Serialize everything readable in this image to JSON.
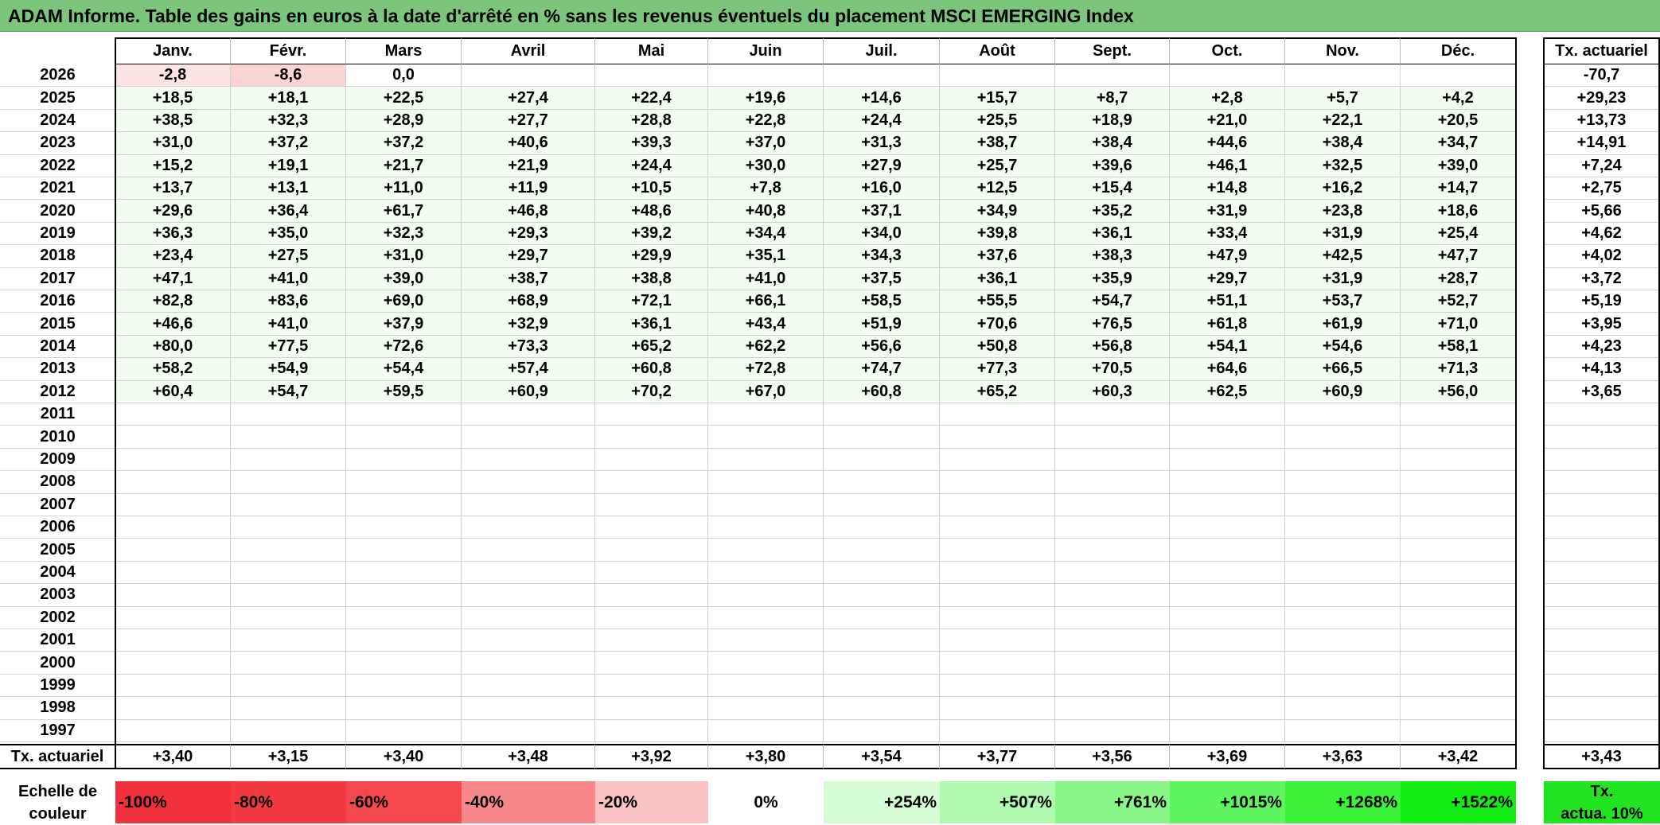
{
  "title": "ADAM Informe. Table des gains en euros à la date d'arrêté en % sans les revenus éventuels du placement MSCI EMERGING Index",
  "months": [
    "Janv.",
    "Févr.",
    "Mars",
    "Avril",
    "Mai",
    "Juin",
    "Juil.",
    "Août",
    "Sept.",
    "Oct.",
    "Nov.",
    "Déc."
  ],
  "rate_header": "Tx. actuariel",
  "rows": [
    {
      "year": "2026",
      "values": [
        "-2,8",
        "-8,6",
        "0,0",
        "",
        "",
        "",
        "",
        "",
        "",
        "",
        "",
        ""
      ],
      "rate": "-70,7"
    },
    {
      "year": "2025",
      "values": [
        "+18,5",
        "+18,1",
        "+22,5",
        "+27,4",
        "+22,4",
        "+19,6",
        "+14,6",
        "+15,7",
        "+8,7",
        "+2,8",
        "+5,7",
        "+4,2"
      ],
      "rate": "+29,23"
    },
    {
      "year": "2024",
      "values": [
        "+38,5",
        "+32,3",
        "+28,9",
        "+27,7",
        "+28,8",
        "+22,8",
        "+24,4",
        "+25,5",
        "+18,9",
        "+21,0",
        "+22,1",
        "+20,5"
      ],
      "rate": "+13,73"
    },
    {
      "year": "2023",
      "values": [
        "+31,0",
        "+37,2",
        "+37,2",
        "+40,6",
        "+39,3",
        "+37,0",
        "+31,3",
        "+38,7",
        "+38,4",
        "+44,6",
        "+38,4",
        "+34,7"
      ],
      "rate": "+14,91"
    },
    {
      "year": "2022",
      "values": [
        "+15,2",
        "+19,1",
        "+21,7",
        "+21,9",
        "+24,4",
        "+30,0",
        "+27,9",
        "+25,7",
        "+39,6",
        "+46,1",
        "+32,5",
        "+39,0"
      ],
      "rate": "+7,24"
    },
    {
      "year": "2021",
      "values": [
        "+13,7",
        "+13,1",
        "+11,0",
        "+11,9",
        "+10,5",
        "+7,8",
        "+16,0",
        "+12,5",
        "+15,4",
        "+14,8",
        "+16,2",
        "+14,7"
      ],
      "rate": "+2,75"
    },
    {
      "year": "2020",
      "values": [
        "+29,6",
        "+36,4",
        "+61,7",
        "+46,8",
        "+48,6",
        "+40,8",
        "+37,1",
        "+34,9",
        "+35,2",
        "+31,9",
        "+23,8",
        "+18,6"
      ],
      "rate": "+5,66"
    },
    {
      "year": "2019",
      "values": [
        "+36,3",
        "+35,0",
        "+32,3",
        "+29,3",
        "+39,2",
        "+34,4",
        "+34,0",
        "+39,8",
        "+36,1",
        "+33,4",
        "+31,9",
        "+25,4"
      ],
      "rate": "+4,62"
    },
    {
      "year": "2018",
      "values": [
        "+23,4",
        "+27,5",
        "+31,0",
        "+29,7",
        "+29,9",
        "+35,1",
        "+34,3",
        "+37,6",
        "+38,3",
        "+47,9",
        "+42,5",
        "+47,7"
      ],
      "rate": "+4,02"
    },
    {
      "year": "2017",
      "values": [
        "+47,1",
        "+41,0",
        "+39,0",
        "+38,7",
        "+38,8",
        "+41,0",
        "+37,5",
        "+36,1",
        "+35,9",
        "+29,7",
        "+31,9",
        "+28,7"
      ],
      "rate": "+3,72"
    },
    {
      "year": "2016",
      "values": [
        "+82,8",
        "+83,6",
        "+69,0",
        "+68,9",
        "+72,1",
        "+66,1",
        "+58,5",
        "+55,5",
        "+54,7",
        "+51,1",
        "+53,7",
        "+52,7"
      ],
      "rate": "+5,19"
    },
    {
      "year": "2015",
      "values": [
        "+46,6",
        "+41,0",
        "+37,9",
        "+32,9",
        "+36,1",
        "+43,4",
        "+51,9",
        "+70,6",
        "+76,5",
        "+61,8",
        "+61,9",
        "+71,0"
      ],
      "rate": "+3,95"
    },
    {
      "year": "2014",
      "values": [
        "+80,0",
        "+77,5",
        "+72,6",
        "+73,3",
        "+65,2",
        "+62,2",
        "+56,6",
        "+50,8",
        "+56,8",
        "+54,1",
        "+54,6",
        "+58,1"
      ],
      "rate": "+4,23"
    },
    {
      "year": "2013",
      "values": [
        "+58,2",
        "+54,9",
        "+54,4",
        "+57,4",
        "+60,8",
        "+72,8",
        "+74,7",
        "+77,3",
        "+70,5",
        "+64,6",
        "+66,5",
        "+71,3"
      ],
      "rate": "+4,13"
    },
    {
      "year": "2012",
      "values": [
        "+60,4",
        "+54,7",
        "+59,5",
        "+60,9",
        "+70,2",
        "+67,0",
        "+60,8",
        "+65,2",
        "+60,3",
        "+62,5",
        "+60,9",
        "+56,0"
      ],
      "rate": "+3,65"
    },
    {
      "year": "2011",
      "values": [
        "",
        "",
        "",
        "",
        "",
        "",
        "",
        "",
        "",
        "",
        "",
        ""
      ],
      "rate": ""
    },
    {
      "year": "2010",
      "values": [
        "",
        "",
        "",
        "",
        "",
        "",
        "",
        "",
        "",
        "",
        "",
        ""
      ],
      "rate": ""
    },
    {
      "year": "2009",
      "values": [
        "",
        "",
        "",
        "",
        "",
        "",
        "",
        "",
        "",
        "",
        "",
        ""
      ],
      "rate": ""
    },
    {
      "year": "2008",
      "values": [
        "",
        "",
        "",
        "",
        "",
        "",
        "",
        "",
        "",
        "",
        "",
        ""
      ],
      "rate": ""
    },
    {
      "year": "2007",
      "values": [
        "",
        "",
        "",
        "",
        "",
        "",
        "",
        "",
        "",
        "",
        "",
        ""
      ],
      "rate": ""
    },
    {
      "year": "2006",
      "values": [
        "",
        "",
        "",
        "",
        "",
        "",
        "",
        "",
        "",
        "",
        "",
        ""
      ],
      "rate": ""
    },
    {
      "year": "2005",
      "values": [
        "",
        "",
        "",
        "",
        "",
        "",
        "",
        "",
        "",
        "",
        "",
        ""
      ],
      "rate": ""
    },
    {
      "year": "2004",
      "values": [
        "",
        "",
        "",
        "",
        "",
        "",
        "",
        "",
        "",
        "",
        "",
        ""
      ],
      "rate": ""
    },
    {
      "year": "2003",
      "values": [
        "",
        "",
        "",
        "",
        "",
        "",
        "",
        "",
        "",
        "",
        "",
        ""
      ],
      "rate": ""
    },
    {
      "year": "2002",
      "values": [
        "",
        "",
        "",
        "",
        "",
        "",
        "",
        "",
        "",
        "",
        "",
        ""
      ],
      "rate": ""
    },
    {
      "year": "2001",
      "values": [
        "",
        "",
        "",
        "",
        "",
        "",
        "",
        "",
        "",
        "",
        "",
        ""
      ],
      "rate": ""
    },
    {
      "year": "2000",
      "values": [
        "",
        "",
        "",
        "",
        "",
        "",
        "",
        "",
        "",
        "",
        "",
        ""
      ],
      "rate": ""
    },
    {
      "year": "1999",
      "values": [
        "",
        "",
        "",
        "",
        "",
        "",
        "",
        "",
        "",
        "",
        "",
        ""
      ],
      "rate": ""
    },
    {
      "year": "1998",
      "values": [
        "",
        "",
        "",
        "",
        "",
        "",
        "",
        "",
        "",
        "",
        "",
        ""
      ],
      "rate": ""
    },
    {
      "year": "1997",
      "values": [
        "",
        "",
        "",
        "",
        "",
        "",
        "",
        "",
        "",
        "",
        "",
        ""
      ],
      "rate": ""
    }
  ],
  "summary": {
    "label": "Tx. actuariel",
    "values": [
      "+3,40",
      "+3,15",
      "+3,40",
      "+3,48",
      "+3,92",
      "+3,80",
      "+3,54",
      "+3,77",
      "+3,56",
      "+3,69",
      "+3,63",
      "+3,42"
    ],
    "rate": "+3,43"
  },
  "legend": {
    "label_line1": "Echelle de",
    "label_line2": "couleur",
    "scale": [
      "-100%",
      "-80%",
      "-60%",
      "-40%",
      "-20%",
      "0%",
      "+254%",
      "+507%",
      "+761%",
      "+1015%",
      "+1268%",
      "+1522%"
    ],
    "scale_colors": [
      "#f0303a",
      "#f33a42",
      "#f5474e",
      "#f7878b",
      "#fbc2c4",
      "#ffffff",
      "#d6fcd6",
      "#b0f9b0",
      "#88f788",
      "#5ff55f",
      "#3cf33c",
      "#14ee14"
    ],
    "rate_line1": "Tx.",
    "rate_line2": "actua. 10%",
    "rate_color": "#22e322"
  },
  "colors": {
    "negative_small": "#fde4e4",
    "negative_mid": "#fbd3d3",
    "positive_light": "#f3fcf1",
    "title_bg": "#7cc57c"
  }
}
